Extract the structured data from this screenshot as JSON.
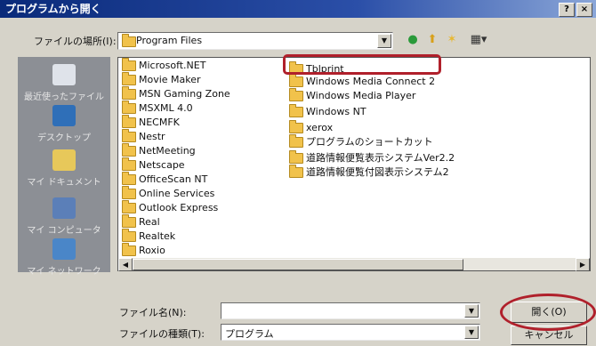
{
  "dialog": {
    "title": "プログラムから開く",
    "help_button": "?",
    "close_button": "×"
  },
  "toolbar": {
    "lookin_label": "ファイルの場所(I):",
    "lookin_value": "Program Files",
    "icons": [
      "back-icon",
      "up-folder-icon",
      "new-folder-icon",
      "view-menu-icon"
    ]
  },
  "places": [
    {
      "label": "最近使ったファイル",
      "icon": "recent-files-icon"
    },
    {
      "label": "デスクトップ",
      "icon": "desktop-icon"
    },
    {
      "label": "マイ ドキュメント",
      "icon": "my-documents-icon"
    },
    {
      "label": "マイ コンピュータ",
      "icon": "my-computer-icon"
    },
    {
      "label": "マイ ネットワーク",
      "icon": "my-network-icon"
    }
  ],
  "files": {
    "col1": [
      "Microsoft.NET",
      "Movie Maker",
      "MSN Gaming Zone",
      "MSXML 4.0",
      "NECMFK",
      "Nestr",
      "NetMeeting",
      "Netscape",
      "OfficeScan NT",
      "Online Services",
      "Outlook Express",
      "Real",
      "Realtek",
      "Roxio"
    ],
    "col2": [
      "Tblprint",
      "Windows Media Connect 2",
      "Windows Media Player",
      "Windows NT",
      "xerox",
      "プログラムのショートカット",
      "道路情報便覧表示システムVer2.2",
      "道路情報便覧付図表示システム2"
    ]
  },
  "bottom": {
    "filename_label": "ファイル名(N):",
    "filename_value": "",
    "filetype_label": "ファイルの種類(T):",
    "filetype_value": "プログラム",
    "open_button": "開く(O)",
    "cancel_button": "キャンセル"
  },
  "colors": {
    "highlight": "#b0202b",
    "titlebar": "#0a2a7a",
    "sidebar": "#8c8f95"
  }
}
